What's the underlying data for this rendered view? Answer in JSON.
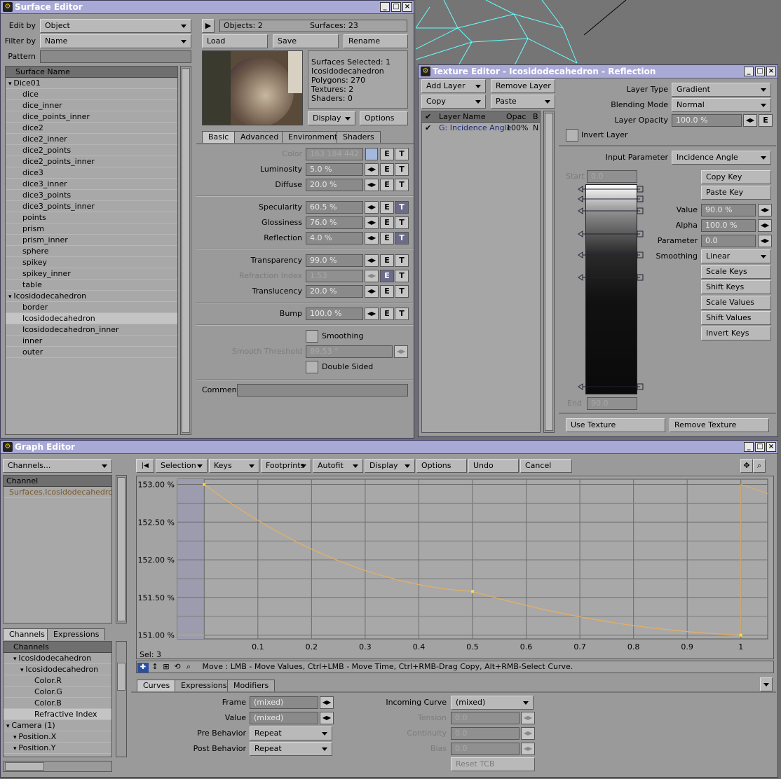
{
  "surface_editor": {
    "title": "Surface Editor",
    "edit_by_label": "Edit by",
    "edit_by_value": "Object",
    "filter_by_label": "Filter by",
    "filter_by_value": "Name",
    "pattern_label": "Pattern",
    "pattern_value": "",
    "objects": "Objects: 2",
    "surfaces": "Surfaces: 23",
    "load": "Load",
    "save": "Save",
    "rename": "Rename",
    "info": [
      "Surfaces Selected: 1",
      "Icosidodecahedron",
      "Polygons: 270",
      "Textures: 2",
      "Shaders: 0"
    ],
    "display": "Display",
    "options": "Options",
    "list_header": "Surface Name",
    "surface_list": [
      {
        "label": "Dice01",
        "level": 0,
        "group": true
      },
      {
        "label": "dice",
        "level": 1
      },
      {
        "label": "dice_inner",
        "level": 1
      },
      {
        "label": "dice_points_inner",
        "level": 1
      },
      {
        "label": "dice2",
        "level": 1
      },
      {
        "label": "dice2_inner",
        "level": 1
      },
      {
        "label": "dice2_points",
        "level": 1
      },
      {
        "label": "dice2_points_inner",
        "level": 1
      },
      {
        "label": "dice3",
        "level": 1
      },
      {
        "label": "dice3_inner",
        "level": 1
      },
      {
        "label": "dice3_points",
        "level": 1
      },
      {
        "label": "dice3_points_inner",
        "level": 1
      },
      {
        "label": "points",
        "level": 1
      },
      {
        "label": "prism",
        "level": 1
      },
      {
        "label": "prism_inner",
        "level": 1
      },
      {
        "label": "sphere",
        "level": 1
      },
      {
        "label": "spikey",
        "level": 1
      },
      {
        "label": "spikey_inner",
        "level": 1
      },
      {
        "label": "table",
        "level": 1
      },
      {
        "label": "Icosidodecahedron",
        "level": 0,
        "group": true
      },
      {
        "label": "border",
        "level": 1
      },
      {
        "label": "Icosidodecahedron",
        "level": 1,
        "selected": true
      },
      {
        "label": "Icosidodecahedron_inner",
        "level": 1
      },
      {
        "label": "inner",
        "level": 1
      },
      {
        "label": "outer",
        "level": 1
      }
    ],
    "tabs": [
      "Basic",
      "Advanced",
      "Environment",
      "Shaders"
    ],
    "color_label": "Color",
    "color_value": "163  184  442",
    "params": [
      {
        "label": "Luminosity",
        "value": "5.0 %"
      },
      {
        "label": "Diffuse",
        "value": "20.0 %"
      },
      {
        "label": "Specularity",
        "value": "60.5 %"
      },
      {
        "label": "Glossiness",
        "value": "76.0 %"
      },
      {
        "label": "Reflection",
        "value": "4.0 %"
      },
      {
        "label": "Transparency",
        "value": "99.0 %"
      },
      {
        "label": "Refraction Index",
        "value": "1.53"
      },
      {
        "label": "Translucency",
        "value": "20.0 %"
      },
      {
        "label": "Bump",
        "value": "100.0 %"
      }
    ],
    "e": "E",
    "t": "T",
    "smoothing": "Smoothing",
    "smooth_threshold_label": "Smooth Threshold",
    "smooth_threshold_value": "89.53 °",
    "double_sided": "Double Sided",
    "comment_label": "Comment",
    "comment_value": ""
  },
  "texture_editor": {
    "title": "Texture Editor - Icosidodecahedron - Reflection",
    "add_layer": "Add Layer",
    "remove_layer": "Remove Layer",
    "copy": "Copy",
    "paste": "Paste",
    "col_layer": "Layer Name",
    "col_opac": "Opac",
    "col_b": "B",
    "layer_row": {
      "name": "G: Incidence Angle",
      "opac": "100%",
      "b": "N"
    },
    "layer_type_label": "Layer Type",
    "layer_type": "Gradient",
    "blending_mode_label": "Blending Mode",
    "blending_mode": "Normal",
    "layer_opacity_label": "Layer Opacity",
    "layer_opacity": "100.0 %",
    "invert_layer": "Invert Layer",
    "input_param_label": "Input Parameter",
    "input_param": "Incidence Angle",
    "start_label": "Start",
    "start_value": "0.0",
    "end_label": "End",
    "end_value": "90.0",
    "copy_key": "Copy Key",
    "paste_key": "Paste Key",
    "value_label": "Value",
    "value": "90.0 %",
    "alpha_label": "Alpha",
    "alpha": "100.0 %",
    "parameter_label": "Parameter",
    "parameter": "0.0",
    "smoothing_label": "Smoothing",
    "smoothing": "Linear",
    "scale_keys": "Scale Keys",
    "shift_keys": "Shift Keys",
    "scale_values": "Scale Values",
    "shift_values": "Shift Values",
    "invert_keys": "Invert Keys",
    "use_texture": "Use Texture",
    "remove_texture": "Remove Texture"
  },
  "graph_editor": {
    "title": "Graph Editor",
    "channels_dropdown": "Channels...",
    "channel_header": "Channel",
    "channel_item": "Surfaces.Icosidodecahedron...",
    "toolbar": [
      "Selection",
      "Keys",
      "Footprints",
      "Autofit",
      "Display",
      "Options",
      "Undo",
      "Cancel"
    ],
    "sel": "Sel: 3",
    "status": "Move   :  LMB - Move Values, Ctrl+LMB - Move Time, Ctrl+RMB-Drag Copy, Alt+RMB-Select Curve.",
    "left_tabs": [
      "Channels",
      "Expressions"
    ],
    "tree_header": "Channels",
    "tree": [
      {
        "label": "Icosidodecahedron",
        "level": 1
      },
      {
        "label": "Icosidodecahedron",
        "level": 2
      },
      {
        "label": "Color.R",
        "level": 3
      },
      {
        "label": "Color.G",
        "level": 3
      },
      {
        "label": "Color.B",
        "level": 3
      },
      {
        "label": "Refractive Index",
        "level": 3,
        "selected": true
      },
      {
        "label": "Camera (1)",
        "level": 0
      },
      {
        "label": "Position.X",
        "level": 1
      },
      {
        "label": "Position.Y",
        "level": 1
      }
    ],
    "bottom_tabs": [
      "Curves",
      "Expressions",
      "Modifiers"
    ],
    "frame_label": "Frame",
    "frame_value": "(mixed)",
    "value_label": "Value",
    "value_value": "(mixed)",
    "pre_label": "Pre Behavior",
    "pre_value": "Repeat",
    "post_label": "Post Behavior",
    "post_value": "Repeat",
    "incoming_label": "Incoming Curve",
    "incoming_value": "(mixed)",
    "tension_label": "Tension",
    "continuity_label": "Continuity",
    "bias_label": "Bias",
    "tcb_value": "0.0",
    "reset_tcb": "Reset TCB"
  },
  "chart_data": {
    "type": "line",
    "ylim": [
      150.95,
      153.07
    ],
    "xlim": [
      -0.05,
      1.05
    ],
    "yticks": [
      "153.00 %",
      "152.50 %",
      "152.00 %",
      "151.50 %",
      "151.00 %"
    ],
    "ytick_values": [
      153.0,
      152.5,
      152.0,
      151.5,
      151.0
    ],
    "xticks": [
      "0.1",
      "0.2",
      "0.3",
      "0.4",
      "0.5",
      "0.6",
      "0.7",
      "0.8",
      "0.9",
      "1"
    ],
    "xtick_values": [
      0.1,
      0.2,
      0.3,
      0.4,
      0.5,
      0.6,
      0.7,
      0.8,
      0.9,
      1.0
    ],
    "series": [
      {
        "x": [
          0,
          0.5,
          1.0
        ],
        "y": [
          153.0,
          151.58,
          151.0
        ]
      }
    ],
    "key_color": "#f0e040",
    "curve_color": "#e8b060"
  }
}
